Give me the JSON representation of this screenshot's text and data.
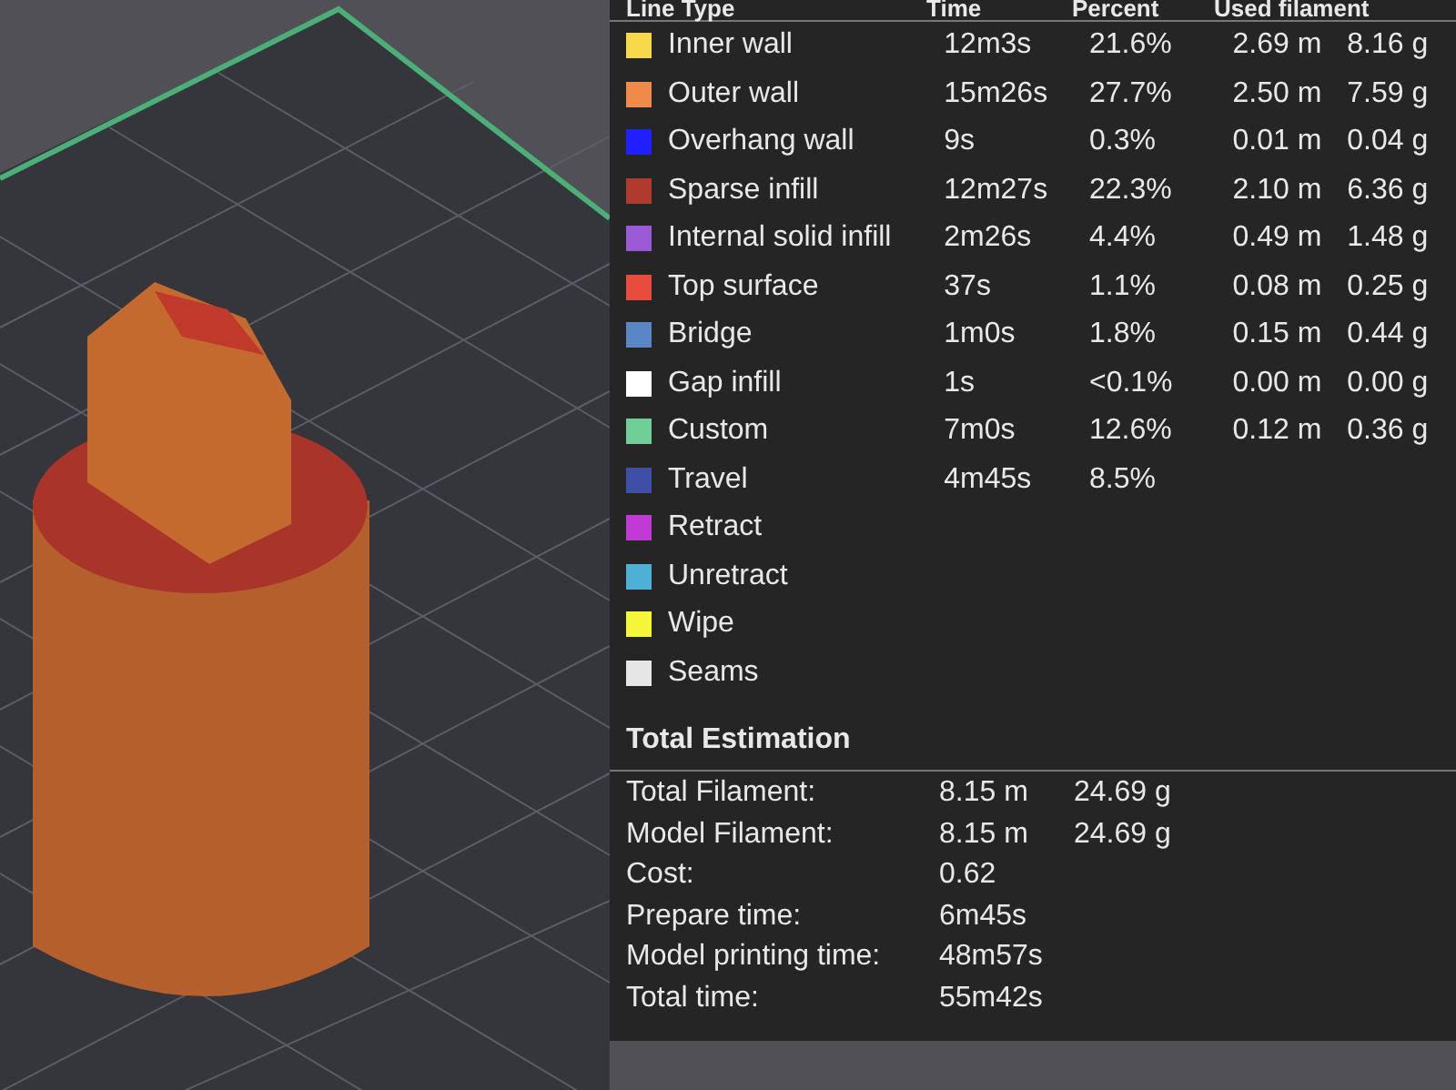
{
  "legend": {
    "columns": [
      "Line Type",
      "Time",
      "Percent",
      "Used filament"
    ],
    "rows": [
      {
        "color": "#f7d94c",
        "name": "Inner wall",
        "time": "12m3s",
        "percent": "21.6%",
        "length": "2.69 m",
        "weight": "8.16 g"
      },
      {
        "color": "#f08a4b",
        "name": "Outer wall",
        "time": "15m26s",
        "percent": "27.7%",
        "length": "2.50 m",
        "weight": "7.59 g"
      },
      {
        "color": "#1f1fff",
        "name": "Overhang wall",
        "time": "9s",
        "percent": "0.3%",
        "length": "0.01 m",
        "weight": "0.04 g"
      },
      {
        "color": "#b03a2e",
        "name": "Sparse infill",
        "time": "12m27s",
        "percent": "22.3%",
        "length": "2.10 m",
        "weight": "6.36 g"
      },
      {
        "color": "#9b59d6",
        "name": "Internal solid infill",
        "time": "2m26s",
        "percent": "4.4%",
        "length": "0.49 m",
        "weight": "1.48 g"
      },
      {
        "color": "#e74c3c",
        "name": "Top surface",
        "time": "37s",
        "percent": "1.1%",
        "length": "0.08 m",
        "weight": "0.25 g"
      },
      {
        "color": "#5b86c5",
        "name": "Bridge",
        "time": "1m0s",
        "percent": "1.8%",
        "length": "0.15 m",
        "weight": "0.44 g"
      },
      {
        "color": "#ffffff",
        "name": "Gap infill",
        "time": "1s",
        "percent": "<0.1%",
        "length": "0.00 m",
        "weight": "0.00 g"
      },
      {
        "color": "#6fcf97",
        "name": "Custom",
        "time": "7m0s",
        "percent": "12.6%",
        "length": "0.12 m",
        "weight": "0.36 g"
      },
      {
        "color": "#3f4fa8",
        "name": "Travel",
        "time": "4m45s",
        "percent": "8.5%"
      },
      {
        "color": "#c13ad6",
        "name": "Retract"
      },
      {
        "color": "#4fb0d6",
        "name": "Unretract"
      },
      {
        "color": "#f5f53a",
        "name": "Wipe"
      },
      {
        "color": "#e6e6e6",
        "name": "Seams"
      }
    ]
  },
  "total_estimation": {
    "title": "Total Estimation",
    "rows": [
      {
        "label": "Total Filament:",
        "values": [
          "8.15 m",
          "24.69 g"
        ]
      },
      {
        "label": "Model Filament:",
        "values": [
          "8.15 m",
          "24.69 g"
        ]
      },
      {
        "label": "Cost:",
        "values": [
          "0.62"
        ]
      },
      {
        "label": "Prepare time:",
        "values": [
          "6m45s"
        ]
      },
      {
        "label": "Model printing time:",
        "values": [
          "48m57s"
        ]
      },
      {
        "label": "Total time:",
        "values": [
          "55m42s"
        ]
      }
    ]
  }
}
